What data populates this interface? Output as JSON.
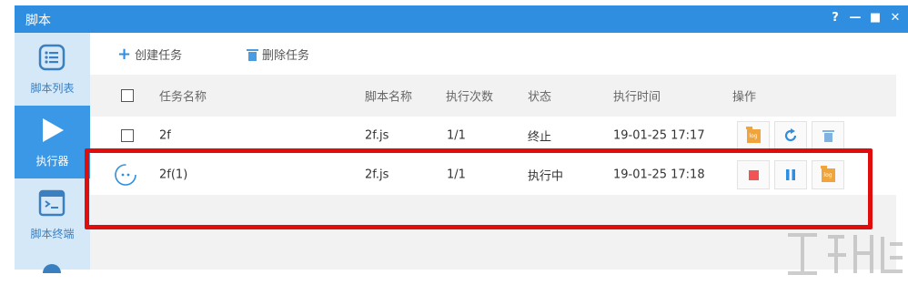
{
  "window": {
    "title": "脚本"
  },
  "window_controls": {
    "help": "?",
    "minimize": "—",
    "maximize": "■",
    "close": "✕"
  },
  "sidebar": {
    "items": [
      {
        "label": "脚本列表",
        "icon": "list-icon",
        "active": false
      },
      {
        "label": "执行器",
        "icon": "play-icon",
        "active": true
      },
      {
        "label": "脚本终端",
        "icon": "terminal-icon",
        "active": false
      }
    ]
  },
  "toolbar": {
    "create_label": "创建任务",
    "delete_label": "删除任务"
  },
  "table": {
    "headers": [
      "任务名称",
      "脚本名称",
      "执行次数",
      "状态",
      "执行时间",
      "操作"
    ],
    "rows": [
      {
        "name": "2f",
        "script": "2f.js",
        "count": "1/1",
        "status": "终止",
        "time": "19-01-25 17:17",
        "actions": [
          "log-icon",
          "refresh-icon",
          "trash-icon"
        ]
      },
      {
        "name": "2f(1)",
        "script": "2f.js",
        "count": "1/1",
        "status": "执行中",
        "time": "19-01-25 17:18",
        "actions": [
          "stop-icon",
          "pause-icon",
          "log-icon"
        ]
      }
    ]
  },
  "log_icon_text": "log",
  "colors": {
    "titlebar": "#2f8ee0",
    "accent": "#3a98e6",
    "highlight": "#e00d0d",
    "log": "#f0a43c",
    "stop": "#f05454"
  }
}
